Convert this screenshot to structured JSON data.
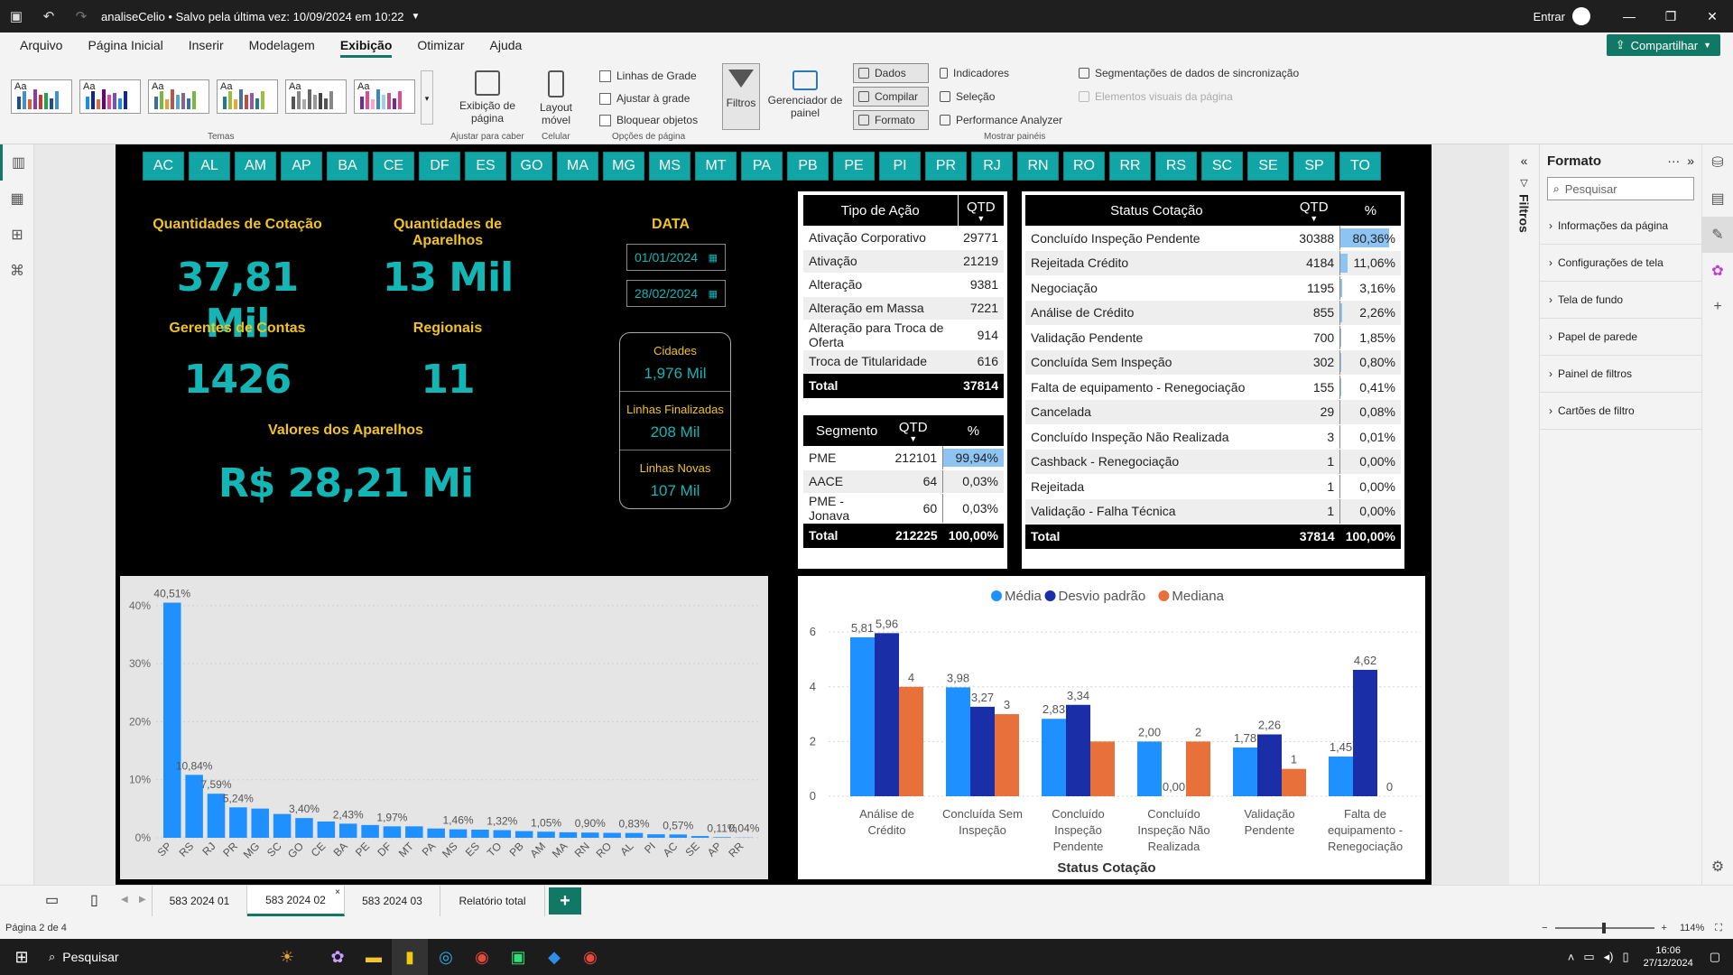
{
  "titlebar": {
    "title": "analiseCelio • Salvo pela última vez: 10/09/2024 em 10:22",
    "signin": "Entrar"
  },
  "menu": {
    "items": [
      "Arquivo",
      "Página Inicial",
      "Inserir",
      "Modelagem",
      "Exibição",
      "Otimizar",
      "Ajuda"
    ],
    "active": "Exibição",
    "share_label": "Compartilhar"
  },
  "ribbon": {
    "themes_label": "Temas",
    "page_view": "Exibição de página",
    "page_view_group": "Ajustar para caber",
    "mobile_layout": "Layout móvel",
    "mobile_group": "Celular",
    "gridlines": "Linhas de Grade",
    "snap": "Ajustar à grade",
    "lock": "Bloquear objetos",
    "page_options": "Opções de página",
    "filters": "Filtros",
    "panel_manager": "Gerenciador de painel",
    "data": "Dados",
    "build": "Compilar",
    "format": "Formato",
    "bookmarks": "Indicadores",
    "selection": "Seleção",
    "perf": "Performance Analyzer",
    "sync_slicers": "Segmentações de dados de sincronização",
    "page_visuals": "Elementos visuais da página",
    "show_panels": "Mostrar painéis"
  },
  "states": [
    "AC",
    "AL",
    "AM",
    "AP",
    "BA",
    "CE",
    "DF",
    "ES",
    "GO",
    "MA",
    "MG",
    "MS",
    "MT",
    "PA",
    "PB",
    "PE",
    "PI",
    "PR",
    "RJ",
    "RN",
    "RO",
    "RR",
    "RS",
    "SC",
    "SE",
    "SP",
    "TO"
  ],
  "kpis": {
    "cotacao_label": "Quantidades de Cotação",
    "cotacao_value": "37,81 Mil",
    "aparelhos_label": "Quantidades de Aparelhos",
    "aparelhos_value": "13 Mil",
    "gerentes_label": "Gerentes de Contas",
    "gerentes_value": "1426",
    "regionais_label": "Regionais",
    "regionais_value": "11",
    "valores_label": "Valores dos Aparelhos",
    "valores_value": "R$ 28,21 Mi"
  },
  "date": {
    "label": "DATA",
    "start": "01/01/2024",
    "end": "28/02/2024"
  },
  "info_card": {
    "cidades_label": "Cidades",
    "cidades_value": "1,976 Mil",
    "finalizadas_label": "Linhas Finalizadas",
    "finalizadas_value": "208 Mil",
    "novas_label": "Linhas Novas",
    "novas_value": "107 Mil"
  },
  "tipo_acao": {
    "headers": [
      "Tipo de Ação",
      "QTD"
    ],
    "rows": [
      {
        "name": "Ativação Corporativo",
        "qtd": "29771"
      },
      {
        "name": "Ativação",
        "qtd": "21219"
      },
      {
        "name": "Alteração",
        "qtd": "9381"
      },
      {
        "name": "Alteração em Massa",
        "qtd": "7221"
      },
      {
        "name": "Alteração para Troca de Oferta",
        "qtd": "914"
      },
      {
        "name": "Troca de Titularidade",
        "qtd": "616"
      }
    ],
    "total_label": "Total",
    "total_qtd": "37814"
  },
  "segmento": {
    "headers": [
      "Segmento",
      "QTD",
      "%"
    ],
    "rows": [
      {
        "name": "PME",
        "qtd": "212101",
        "pct": "99,94%",
        "frac": 0.9994
      },
      {
        "name": "AACE",
        "qtd": "64",
        "pct": "0,03%",
        "frac": 0.0003
      },
      {
        "name": "PME - Jonava",
        "qtd": "60",
        "pct": "0,03%",
        "frac": 0.0003
      }
    ],
    "total_label": "Total",
    "total_qtd": "212225",
    "total_pct": "100,00%"
  },
  "status_cotacao": {
    "headers": [
      "Status Cotação",
      "QTD",
      "%"
    ],
    "rows": [
      {
        "name": "Concluído Inspeção Pendente",
        "qtd": "30388",
        "pct": "80,36%",
        "frac": 0.8036
      },
      {
        "name": "Rejeitada Crédito",
        "qtd": "4184",
        "pct": "11,06%",
        "frac": 0.1106
      },
      {
        "name": "Negociação",
        "qtd": "1195",
        "pct": "3,16%",
        "frac": 0.0316
      },
      {
        "name": "Análise de Crédito",
        "qtd": "855",
        "pct": "2,26%",
        "frac": 0.0226
      },
      {
        "name": "Validação Pendente",
        "qtd": "700",
        "pct": "1,85%",
        "frac": 0.0185
      },
      {
        "name": "Concluída Sem Inspeção",
        "qtd": "302",
        "pct": "0,80%",
        "frac": 0.008
      },
      {
        "name": "Falta de equipamento - Renegociação",
        "qtd": "155",
        "pct": "0,41%",
        "frac": 0.0041
      },
      {
        "name": "Cancelada",
        "qtd": "29",
        "pct": "0,08%",
        "frac": 0.0008
      },
      {
        "name": "Concluído Inspeção Não Realizada",
        "qtd": "3",
        "pct": "0,01%",
        "frac": 0.0001
      },
      {
        "name": "Cashback - Renegociação",
        "qtd": "1",
        "pct": "0,00%",
        "frac": 0
      },
      {
        "name": "Rejeitada",
        "qtd": "1",
        "pct": "0,00%",
        "frac": 0
      },
      {
        "name": "Validação - Falha Técnica",
        "qtd": "1",
        "pct": "0,00%",
        "frac": 0
      }
    ],
    "total_label": "Total",
    "total_qtd": "37814",
    "total_pct": "100,00%"
  },
  "chart_data": [
    {
      "type": "bar",
      "categories": [
        "SP",
        "RS",
        "RJ",
        "PR",
        "MG",
        "SC",
        "GO",
        "CE",
        "BA",
        "PE",
        "DF",
        "MT",
        "PA",
        "MS",
        "ES",
        "TO",
        "PB",
        "AM",
        "MA",
        "RN",
        "RO",
        "AL",
        "PI",
        "AC",
        "SE",
        "AP",
        "RR"
      ],
      "values": [
        40.51,
        10.84,
        7.59,
        5.24,
        5.03,
        4.1,
        3.4,
        2.8,
        2.43,
        2.2,
        1.97,
        1.97,
        1.6,
        1.46,
        1.4,
        1.32,
        1.15,
        1.05,
        0.95,
        0.9,
        0.85,
        0.83,
        0.6,
        0.57,
        0.3,
        0.11,
        0.04
      ],
      "data_labels": [
        "40,51%",
        "10,84%",
        "7,59%",
        "5,24%",
        "",
        "",
        "3,40%",
        "",
        "2,43%",
        "",
        "1,97%",
        "",
        "",
        "1,46%",
        "",
        "1,32%",
        "",
        "1,05%",
        "",
        "0,90%",
        "",
        "0,83%",
        "",
        "0,57%",
        "",
        "0,11%",
        "0,04%"
      ],
      "yticks": [
        "0%",
        "10%",
        "20%",
        "30%",
        "40%"
      ],
      "ylim": [
        0,
        42
      ],
      "color": "#1e90ff",
      "grid": true
    },
    {
      "type": "bar",
      "categories": [
        "Análise de Crédito",
        "Concluída Sem Inspeção",
        "Concluído Inspeção Pendente",
        "Concluído Inspeção Não Realizada",
        "Validação Pendente",
        "Falta de equipamento - Renegociação"
      ],
      "category_lines": [
        [
          "Análise de",
          "Crédito"
        ],
        [
          "Concluída Sem",
          "Inspeção"
        ],
        [
          "Concluído",
          "Inspeção",
          "Pendente"
        ],
        [
          "Concluído",
          "Inspeção Não",
          "Realizada"
        ],
        [
          "Validação",
          "Pendente"
        ],
        [
          "Falta de",
          "equipamento -",
          "Renegociação"
        ]
      ],
      "series": [
        {
          "name": "Média",
          "color": "#1e90ff",
          "values": [
            5.81,
            3.98,
            2.83,
            2.0,
            1.78,
            1.45
          ],
          "labels": [
            "5,81",
            "3,98",
            "2,83",
            "2,00",
            "1,78",
            "1,45"
          ]
        },
        {
          "name": "Desvio padrão",
          "color": "#1a2ea8",
          "values": [
            5.96,
            3.27,
            3.34,
            0.0,
            2.26,
            4.62
          ],
          "labels": [
            "5,96",
            "3,27",
            "3,34",
            "0,00",
            "2,26",
            "4,62"
          ]
        },
        {
          "name": "Mediana",
          "color": "#e8703a",
          "values": [
            4,
            3,
            2,
            2,
            1,
            0
          ],
          "labels": [
            "4",
            "3",
            "",
            "2",
            "1",
            "0"
          ]
        }
      ],
      "xlabel": "Status Cotação",
      "yticks": [
        "0",
        "2",
        "4",
        "6"
      ],
      "ylim": [
        0,
        6.4
      ],
      "legend": "top-center",
      "grid": true
    }
  ],
  "right_panel": {
    "filters_label": "Filtros",
    "format_title": "Formato",
    "search_placeholder": "Pesquisar",
    "items": [
      "Informações da página",
      "Configurações de tela",
      "Tela de fundo",
      "Papel de parede",
      "Painel de filtros",
      "Cartões de filtro"
    ]
  },
  "tabs": {
    "items": [
      "583 2024 01",
      "583 2024 02",
      "583 2024 03",
      "Relatório total"
    ],
    "active_index": 1,
    "add": "+"
  },
  "status": {
    "page": "Página 2 de 4",
    "zoom": "114%"
  },
  "taskbar": {
    "search": "Pesquisar",
    "time": "16:06",
    "date": "27/12/2024"
  }
}
